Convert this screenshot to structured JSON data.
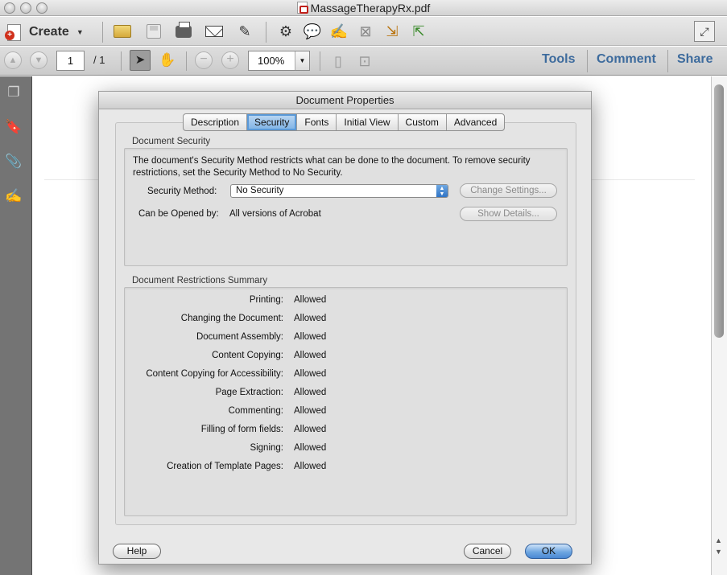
{
  "window": {
    "title": "MassageTherapyRx.pdf"
  },
  "toolbar": {
    "create_label": "Create",
    "page_current": "1",
    "page_total": "/ 1",
    "zoom": "100%",
    "tools_label": "Tools",
    "comment_label": "Comment",
    "share_label": "Share"
  },
  "dialog": {
    "title": "Document Properties",
    "tabs": [
      "Description",
      "Security",
      "Fonts",
      "Initial View",
      "Custom",
      "Advanced"
    ],
    "active_tab": "Security",
    "security": {
      "group_label": "Document Security",
      "description": "The document's Security Method restricts what can be done to the document. To remove security restrictions, set the Security Method to No Security.",
      "method_label": "Security Method:",
      "method_value": "No Security",
      "change_settings": "Change Settings...",
      "opened_by_label": "Can be Opened by:",
      "opened_by_value": "All versions of Acrobat",
      "show_details": "Show Details..."
    },
    "restrictions": {
      "group_label": "Document Restrictions Summary",
      "rows": [
        {
          "label": "Printing:",
          "value": "Allowed"
        },
        {
          "label": "Changing the Document:",
          "value": "Allowed"
        },
        {
          "label": "Document Assembly:",
          "value": "Allowed"
        },
        {
          "label": "Content Copying:",
          "value": "Allowed"
        },
        {
          "label": "Content Copying for Accessibility:",
          "value": "Allowed"
        },
        {
          "label": "Page Extraction:",
          "value": "Allowed"
        },
        {
          "label": "Commenting:",
          "value": "Allowed"
        },
        {
          "label": "Filling of form fields:",
          "value": "Allowed"
        },
        {
          "label": "Signing:",
          "value": "Allowed"
        },
        {
          "label": "Creation of Template Pages:",
          "value": "Allowed"
        }
      ]
    },
    "buttons": {
      "help": "Help",
      "cancel": "Cancel",
      "ok": "OK"
    }
  },
  "colors": {
    "accent": "#3d6b9d",
    "selected_tab": "#7db2e5",
    "default_button": "#4a88d4"
  }
}
